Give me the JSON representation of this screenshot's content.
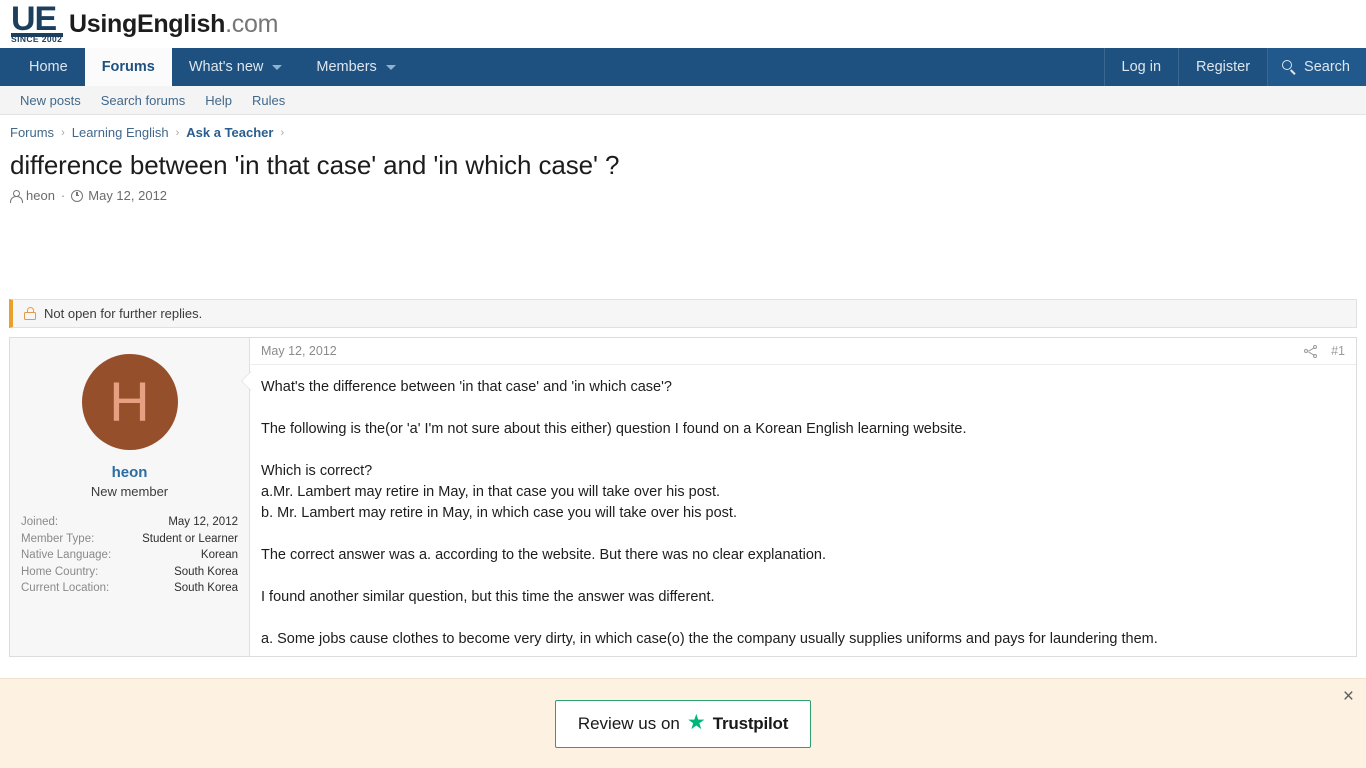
{
  "header": {
    "logo_mark": "UE",
    "logo_since": "SINCE 2002",
    "logo_name": "UsingEnglish",
    "logo_tld": ".com"
  },
  "main_nav": {
    "items": [
      {
        "label": "Home",
        "active": false,
        "caret": false
      },
      {
        "label": "Forums",
        "active": true,
        "caret": false
      },
      {
        "label": "What's new",
        "active": false,
        "caret": true
      },
      {
        "label": "Members",
        "active": false,
        "caret": true
      }
    ],
    "right_items": [
      {
        "label": "Log in"
      },
      {
        "label": "Register"
      },
      {
        "label": "Search",
        "icon": "search-icon"
      }
    ]
  },
  "sub_nav": {
    "items": [
      "New posts",
      "Search forums",
      "Help",
      "Rules"
    ]
  },
  "breadcrumb": {
    "items": [
      "Forums",
      "Learning English",
      "Ask a Teacher"
    ],
    "separator": "›"
  },
  "thread": {
    "title": "difference between 'in that case' and 'in which case' ?",
    "author": "heon",
    "date": "May 12, 2012",
    "separator": "·"
  },
  "notice": {
    "icon": "lock-icon",
    "text": "Not open for further replies."
  },
  "post": {
    "head_date": "May 12, 2012",
    "share_icon": "share-icon",
    "post_number": "#1",
    "user": {
      "avatar_letter": "H",
      "name": "heon",
      "title": "New member",
      "fields": [
        {
          "label": "Joined:",
          "value": "May 12, 2012"
        },
        {
          "label": "Member Type:",
          "value": "Student or Learner"
        },
        {
          "label": "Native Language:",
          "value": "Korean"
        },
        {
          "label": "Home Country:",
          "value": "South Korea"
        },
        {
          "label": "Current Location:",
          "value": "South Korea"
        }
      ]
    },
    "paragraphs": [
      "What's the difference between 'in that case' and 'in which case'?",
      "The following is the(or 'a' I'm not sure about this either) question I found on a Korean English learning website.",
      "Which is correct?\na.Mr. Lambert may retire in May, in that case you will take over his post.\nb. Mr. Lambert may retire in May, in which case you will take over his post.",
      "The correct answer was a. according to the website. But there was no clear explanation.",
      "I found another similar question, but this time the answer was different.",
      "a. Some jobs cause clothes to become very dirty, in which case(o) the the company usually supplies uniforms and pays for laundering them."
    ]
  },
  "promo": {
    "button_prefix": "Review us on",
    "star": "★",
    "brand": "Trustpilot",
    "close": "×"
  },
  "colors": {
    "nav_blue": "#1e5180",
    "link_blue": "#41688b",
    "notice_accent": "#e8a12c",
    "avatar_bg": "#964f2b",
    "trustpilot_green": "#00b67a",
    "banner_bg": "#fdf2e2"
  }
}
